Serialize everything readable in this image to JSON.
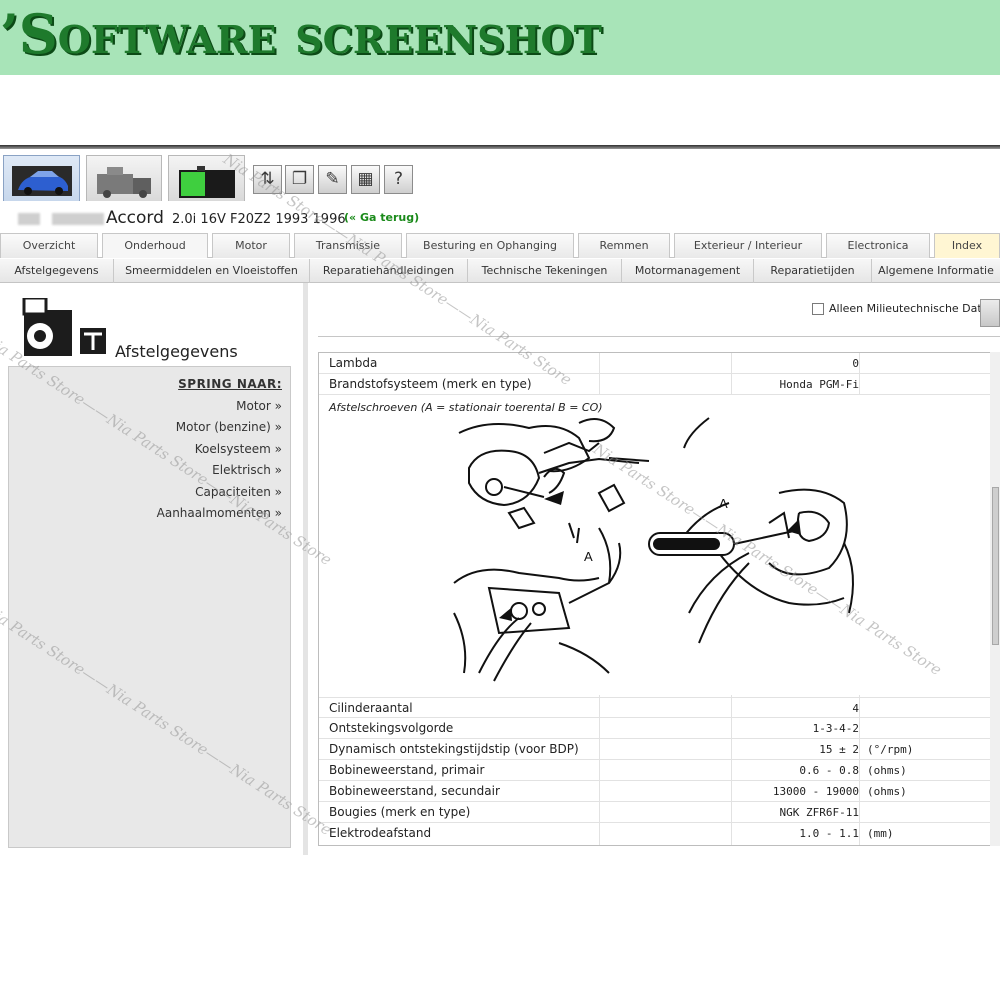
{
  "banner": {
    "title": "’Software screenshot"
  },
  "toolbar": {
    "modules": [
      {
        "name": "car-module",
        "active": true
      },
      {
        "name": "truck-module",
        "active": false
      },
      {
        "name": "battery-module",
        "active": false
      }
    ],
    "tools": [
      "settings-sliders-icon",
      "copy-icon",
      "edit-icon",
      "calculator-icon",
      "help-icon"
    ],
    "tool_glyphs": [
      "⇅",
      "❐",
      "✎",
      "▦",
      "?"
    ]
  },
  "vehicle": {
    "model": "Accord",
    "spec": "2.0i 16V F20Z2 1993 1996",
    "back_link": "(« Ga terug)"
  },
  "main_tabs": [
    "Overzicht",
    "Onderhoud",
    "Motor",
    "Transmissie",
    "Besturing en Ophanging",
    "Remmen",
    "Exterieur / Interieur",
    "Electronica",
    "Index"
  ],
  "sub_tabs": [
    "Afstelgegevens",
    "Smeermiddelen en Vloeistoffen",
    "Reparatiehandleidingen",
    "Technische Tekeningen",
    "Motormanagement",
    "Reparatietijden",
    "Algemene Informatie"
  ],
  "page": {
    "heading": "Afstelgegevens"
  },
  "jump": {
    "title": "SPRING NAAR:",
    "items": [
      "Motor »",
      "Motor (benzine) »",
      "Koelsysteem »",
      "Elektrisch »",
      "Capaciteiten »",
      "Aanhaalmomenten »"
    ]
  },
  "env_filter": {
    "label": "Alleen Milieutechnische Data",
    "checked": false
  },
  "table": {
    "top_rows": [
      {
        "label": "Lambda",
        "value": "0",
        "unit": ""
      },
      {
        "label": "Brandstofsysteem (merk en type)",
        "value": "Honda PGM-Fi",
        "unit": ""
      }
    ],
    "figure_caption": "Afstelschroeven (A = stationair toerental B = CO)",
    "figure_marker": "A",
    "bottom_rows": [
      {
        "label": "Cilinderaantal",
        "value": "4",
        "unit": ""
      },
      {
        "label": "Ontstekingsvolgorde",
        "value": "1-3-4-2",
        "unit": ""
      },
      {
        "label": "Dynamisch ontstekingstijdstip (voor BDP)",
        "value": "15 ± 2",
        "unit": "(°/rpm)"
      },
      {
        "label": "Bobineweerstand, primair",
        "value": "0.6 - 0.8",
        "unit": "(ohms)"
      },
      {
        "label": "Bobineweerstand, secundair",
        "value": "13000 - 19000",
        "unit": "(ohms)"
      },
      {
        "label": "Bougies (merk en type)",
        "value": "NGK ZFR6F-11",
        "unit": ""
      },
      {
        "label": "Elektrodeafstand",
        "value": "1.0 - 1.1",
        "unit": "(mm)"
      }
    ]
  },
  "watermark": {
    "text": "Nia Parts Store——Nia Parts Store——Nia Parts Store"
  },
  "colors": {
    "banner_bg": "#a8e4b8",
    "banner_text": "#1e7a2c",
    "index_tab": "#fff6d3",
    "link_green": "#1a8a1a"
  }
}
